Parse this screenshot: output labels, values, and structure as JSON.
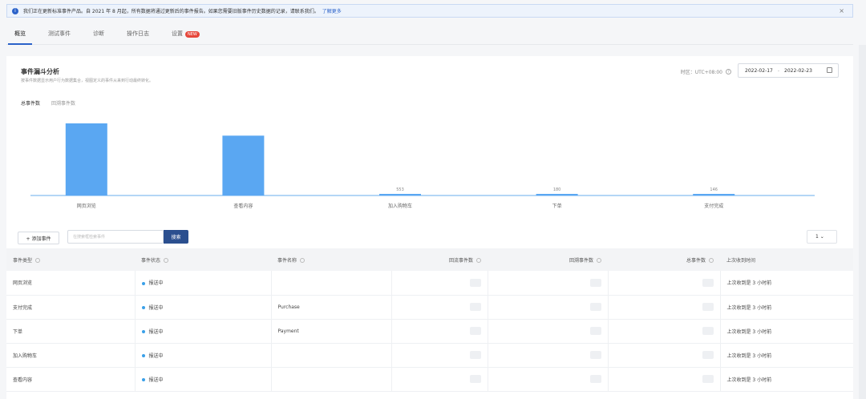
{
  "notice": {
    "text": "我们正在更新标准事件产品。自 2021 年 8 月起，所有数据将通过更新后的事件报告。如果您需要旧版事件历史数据的记录，请联系我们。",
    "link": "了解更多",
    "close": "×"
  },
  "tabs": [
    {
      "label": "概览",
      "active": true
    },
    {
      "label": "测试事件"
    },
    {
      "label": "诊断"
    },
    {
      "label": "操作日志"
    },
    {
      "label": "设置",
      "badge": "NEW"
    }
  ],
  "section": {
    "title": "事件漏斗分析",
    "subtitle": "按事件数据显示用户行为数据集合，视图定义的事件从来到行动最终转化。"
  },
  "timezone": {
    "label": "时区：UTC+08:00"
  },
  "daterange": {
    "start": "2022-02-17",
    "sep": "-",
    "end": "2022-02-23"
  },
  "chart_tabs": {
    "total": "总事件数",
    "returned": "回溯事件数"
  },
  "chart_data": {
    "type": "bar",
    "categories": [
      "网页浏览",
      "查看内容",
      "加入购物车",
      "下单",
      "支付完成"
    ],
    "value_labels": [
      "",
      "",
      "553",
      "180",
      "146"
    ],
    "values": [
      1000,
      830,
      553,
      180,
      146
    ]
  },
  "toolbar": {
    "add_label": "+ 添加事件",
    "search_placeholder": "在搜索框检索事件",
    "search_label": "搜索",
    "page": "1"
  },
  "table": {
    "headers": [
      "事件类型",
      "事件状态",
      "事件名称",
      "回流事件数",
      "回溯事件数",
      "总事件数",
      "上次收到时间"
    ],
    "rows": [
      [
        "网页浏览",
        "报送中",
        "",
        "",
        "",
        "",
        "上次收到是 3 小时前"
      ],
      [
        "支付完成",
        "报送中",
        "Purchase",
        "",
        "",
        "",
        "上次收到是 3 小时前"
      ],
      [
        "下单",
        "报送中",
        "Payment",
        "",
        "",
        "",
        "上次收到是 3 小时前"
      ],
      [
        "加入购物车",
        "报送中",
        "",
        "",
        "",
        "",
        "上次收到是 3 小时前"
      ],
      [
        "查看内容",
        "报送中",
        "",
        "",
        "",
        "",
        "上次收到是 3 小时前"
      ]
    ]
  },
  "colors": {
    "bar": "#5aa7f2",
    "accent": "#2b62c9"
  }
}
